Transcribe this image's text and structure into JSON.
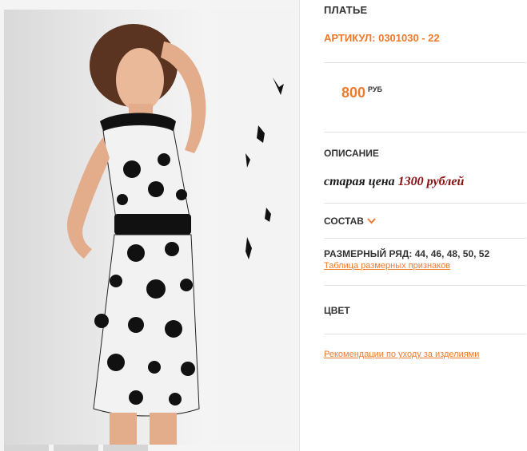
{
  "product": {
    "title": "ПЛАТЬЕ",
    "sku_label": "АРТИКУЛ: 0301030 - 22",
    "price": "800",
    "currency": "РУБ",
    "description_heading": "ОПИСАНИЕ",
    "old_price_prefix": "старая цена ",
    "old_price_value": "1300 рублей",
    "composition_heading": "СОСТАВ",
    "size_range": "РАЗМЕРНЫЙ РЯД: 44, 46, 48, 50, 52",
    "size_table_link": "Таблица размерных признаков",
    "color_heading": "ЦВЕТ",
    "care_link": "Рекомендации по уходу за изделиями"
  },
  "image": {
    "name": "dress-photo",
    "icon": "photo-model-dress"
  },
  "colors": {
    "accent": "#ee7a2d",
    "old_price_accent": "#8b1010",
    "heading": "#333333",
    "divider": "#e2e2e2"
  }
}
